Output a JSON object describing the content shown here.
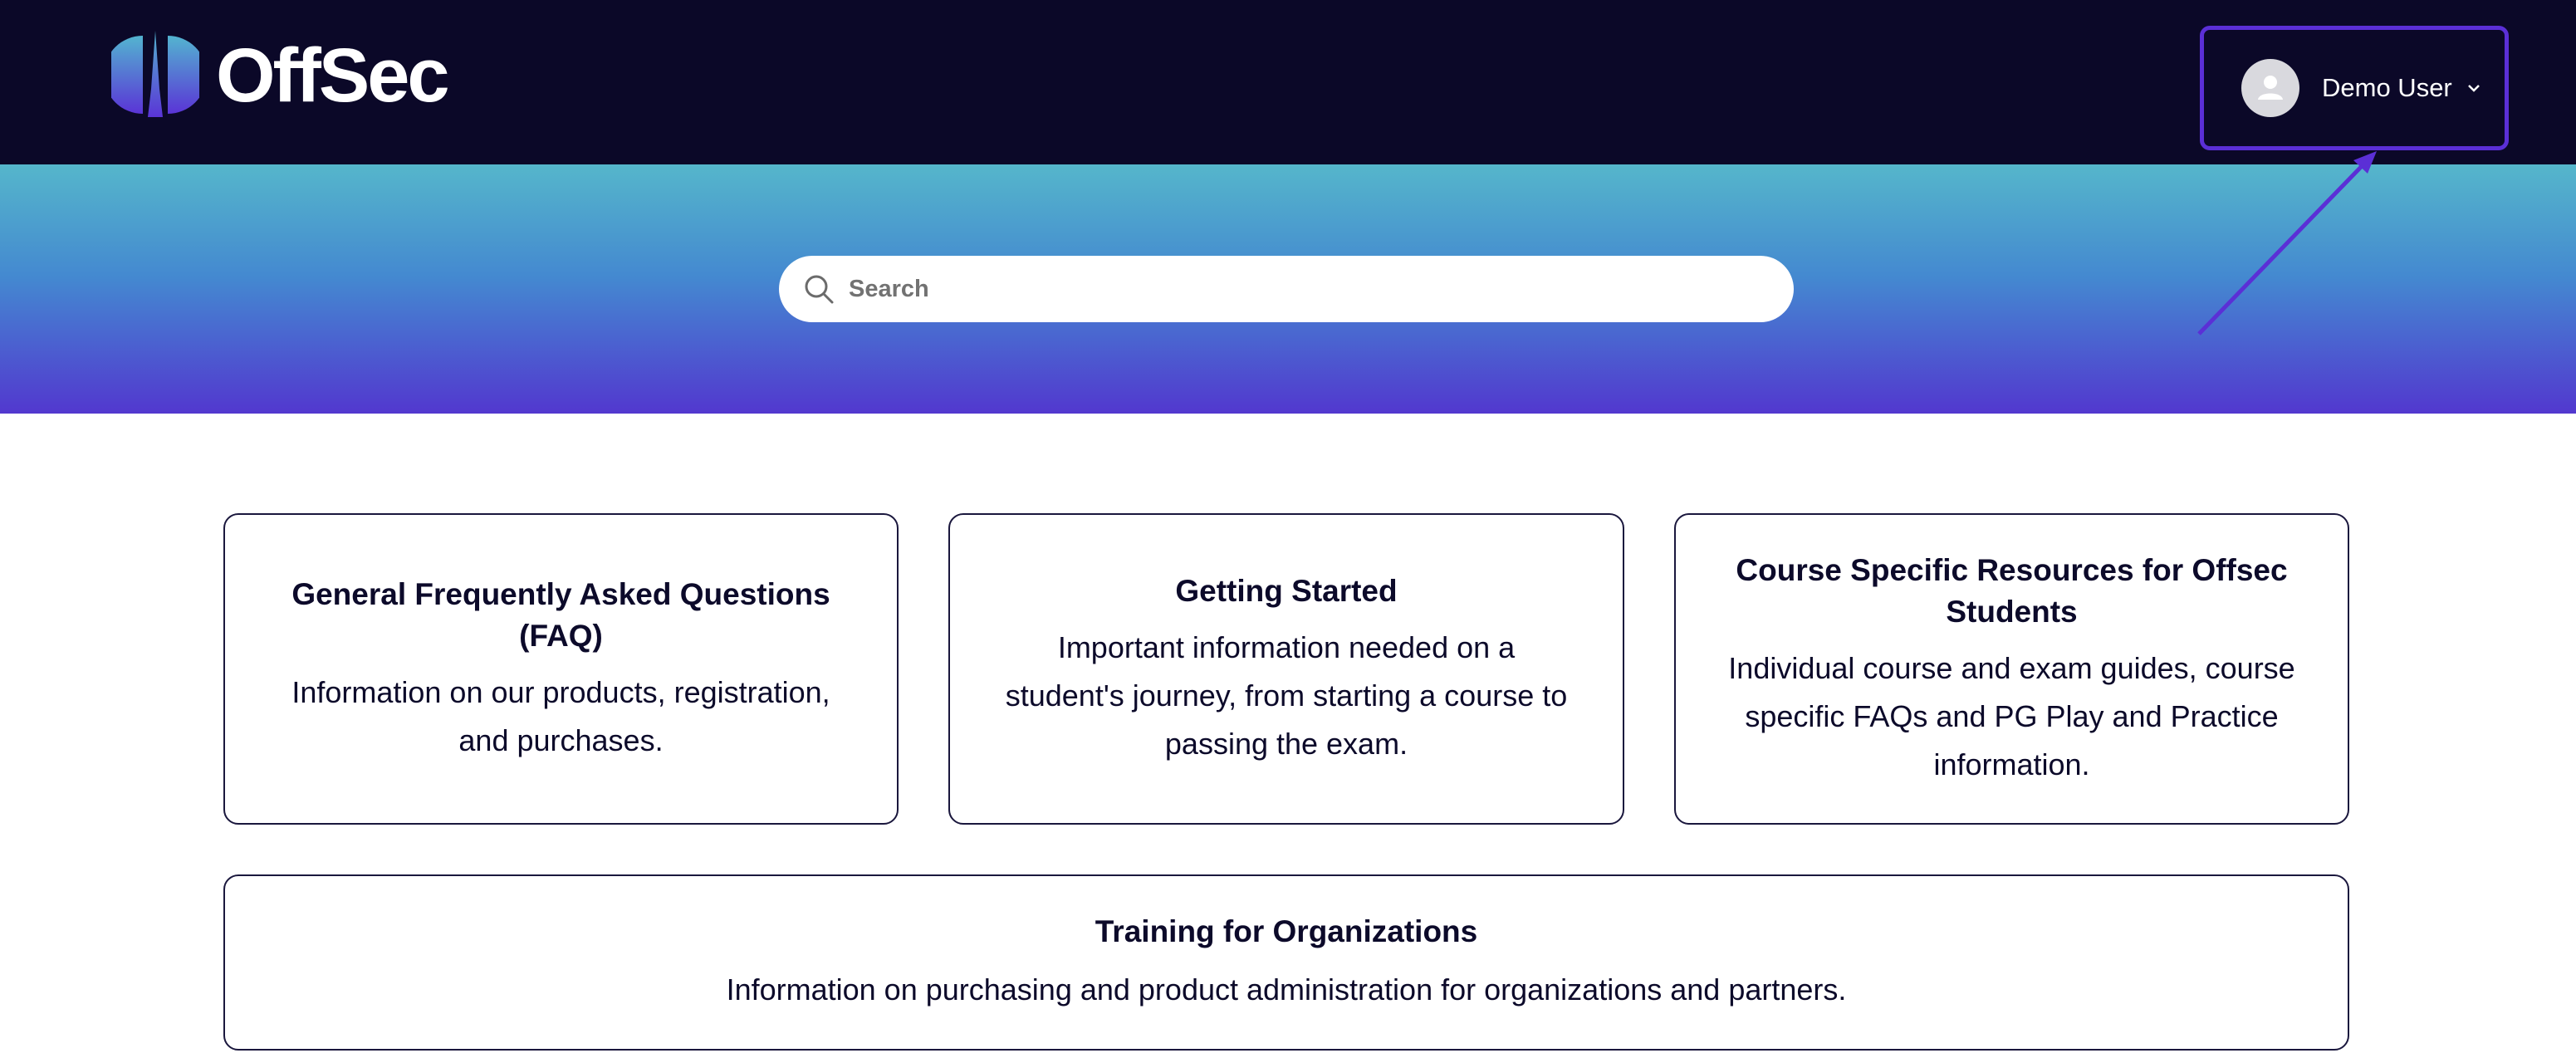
{
  "header": {
    "brand": "OffSec",
    "user": {
      "name": "Demo User"
    }
  },
  "search": {
    "placeholder": "Search"
  },
  "cards": [
    {
      "title": "General Frequently Asked Questions (FAQ)",
      "description": "Information on our products, registration, and purchases."
    },
    {
      "title": "Getting Started",
      "description": "Important information needed on a student's journey, from starting a course to passing the exam."
    },
    {
      "title": "Course Specific Resources for Offsec Students",
      "description": "Individual course and exam guides, course specific FAQs and PG Play and Practice information."
    },
    {
      "title": "Training for Organizations",
      "description": "Information on purchasing and product administration for organizations and partners."
    }
  ],
  "colors": {
    "header_bg": "#0b0828",
    "highlight": "#5b2fd6",
    "hero_top": "#55b6cb",
    "hero_bottom": "#5238cf"
  },
  "icons": [
    "offsec-logo-icon",
    "avatar-icon",
    "chevron-down-icon",
    "search-icon",
    "annotation-arrow-icon"
  ]
}
